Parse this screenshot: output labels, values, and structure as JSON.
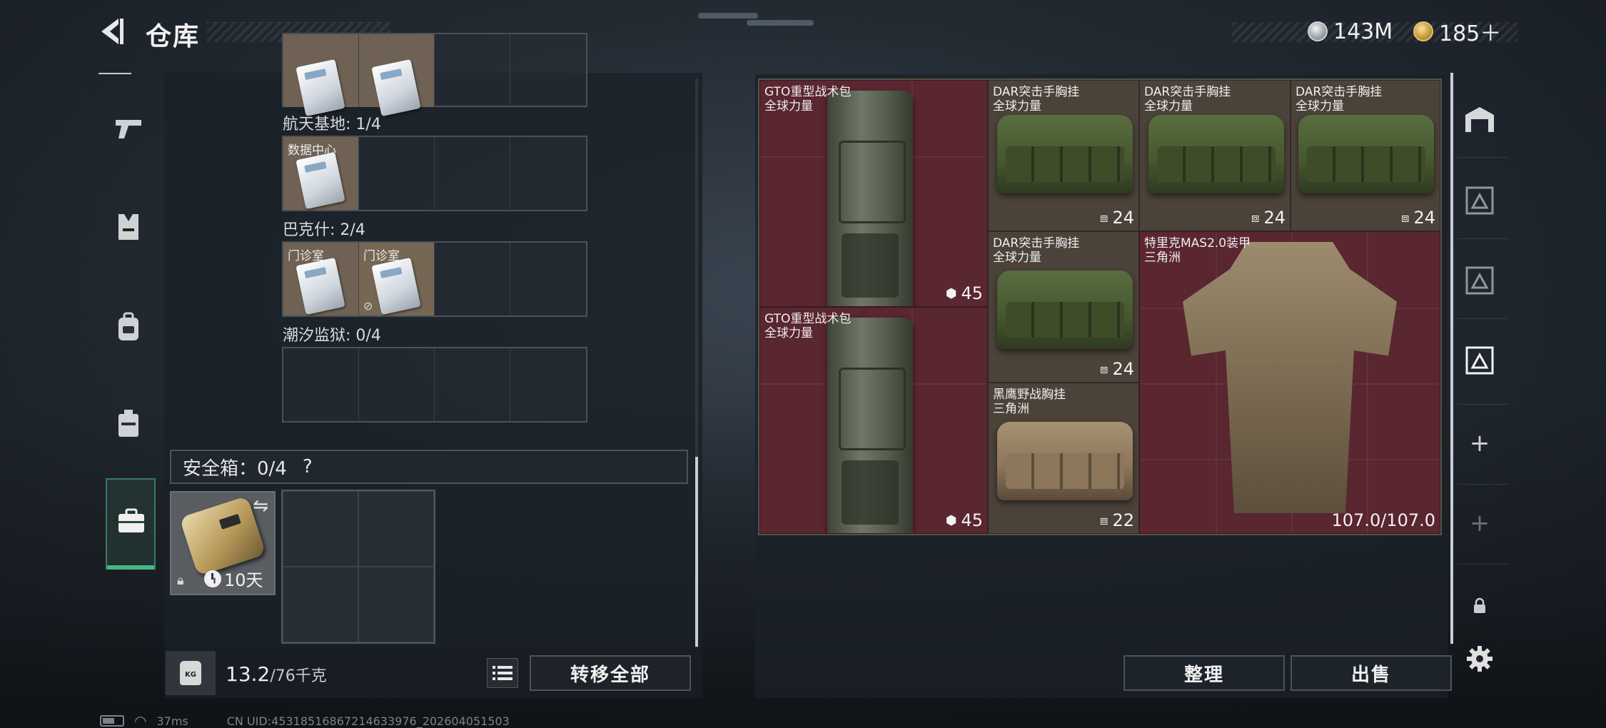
{
  "header": {
    "title": "仓库",
    "silver_amount": "143M",
    "gold_amount": "185＋"
  },
  "left_sidebar": {
    "items": [
      {
        "icon": "pistol-icon"
      },
      {
        "icon": "vest-icon"
      },
      {
        "icon": "backpack-icon"
      },
      {
        "icon": "chest-rig-icon"
      },
      {
        "icon": "briefcase-icon",
        "active": true
      }
    ]
  },
  "keycard_section": {
    "maps": [
      {
        "label": "航天基地: 1/4",
        "slot_labels": [
          "数据中心"
        ]
      },
      {
        "label": "巴克什: 2/4",
        "slot_labels": [
          "门诊室",
          "门诊室"
        ]
      },
      {
        "label": "潮汐监狱: 0/4",
        "slot_labels": []
      }
    ]
  },
  "safe_box": {
    "label": "安全箱：0/4",
    "help": "?",
    "timer": "10天"
  },
  "weight": {
    "icon_text": "KG",
    "current": "13.2",
    "max": "/76千克"
  },
  "buttons": {
    "transfer_all": "转移全部",
    "organize": "整理",
    "sell": "出售"
  },
  "inventory": {
    "items": [
      {
        "name": "GTO重型战术包",
        "sub": "全球力量",
        "value": "45",
        "kind": "backpack"
      },
      {
        "name": "DAR突击手胸挂",
        "sub": "全球力量",
        "value": "24",
        "kind": "rig"
      },
      {
        "name": "DAR突击手胸挂",
        "sub": "全球力量",
        "value": "24",
        "kind": "rig"
      },
      {
        "name": "DAR突击手胸挂",
        "sub": "全球力量",
        "value": "24",
        "kind": "rig"
      },
      {
        "name": "DAR突击手胸挂",
        "sub": "全球力量",
        "value": "24",
        "kind": "rig"
      },
      {
        "name": "特里克MAS2.0装甲",
        "sub": "三角洲",
        "value": "107.0/107.0",
        "kind": "armor"
      },
      {
        "name": "GTO重型战术包",
        "sub": "全球力量",
        "value": "45",
        "kind": "backpack"
      },
      {
        "name": "黑鹰野战胸挂",
        "sub": "三角洲",
        "value": "22",
        "kind": "rig"
      }
    ]
  },
  "right_sidebar": {
    "items": [
      {
        "icon": "warehouse-icon"
      },
      {
        "icon": "storage-tab-1-icon"
      },
      {
        "icon": "storage-tab-2-icon"
      },
      {
        "icon": "storage-tab-3-icon"
      },
      {
        "icon": "add-tab-icon",
        "label": "+"
      },
      {
        "icon": "add-tab-disabled-icon",
        "label": "+"
      },
      {
        "icon": "lock-icon"
      },
      {
        "icon": "gear-icon"
      }
    ]
  },
  "status_bar": {
    "ping": "37ms",
    "uid": "CN UID:4531851686721463​3976_202604051503"
  }
}
